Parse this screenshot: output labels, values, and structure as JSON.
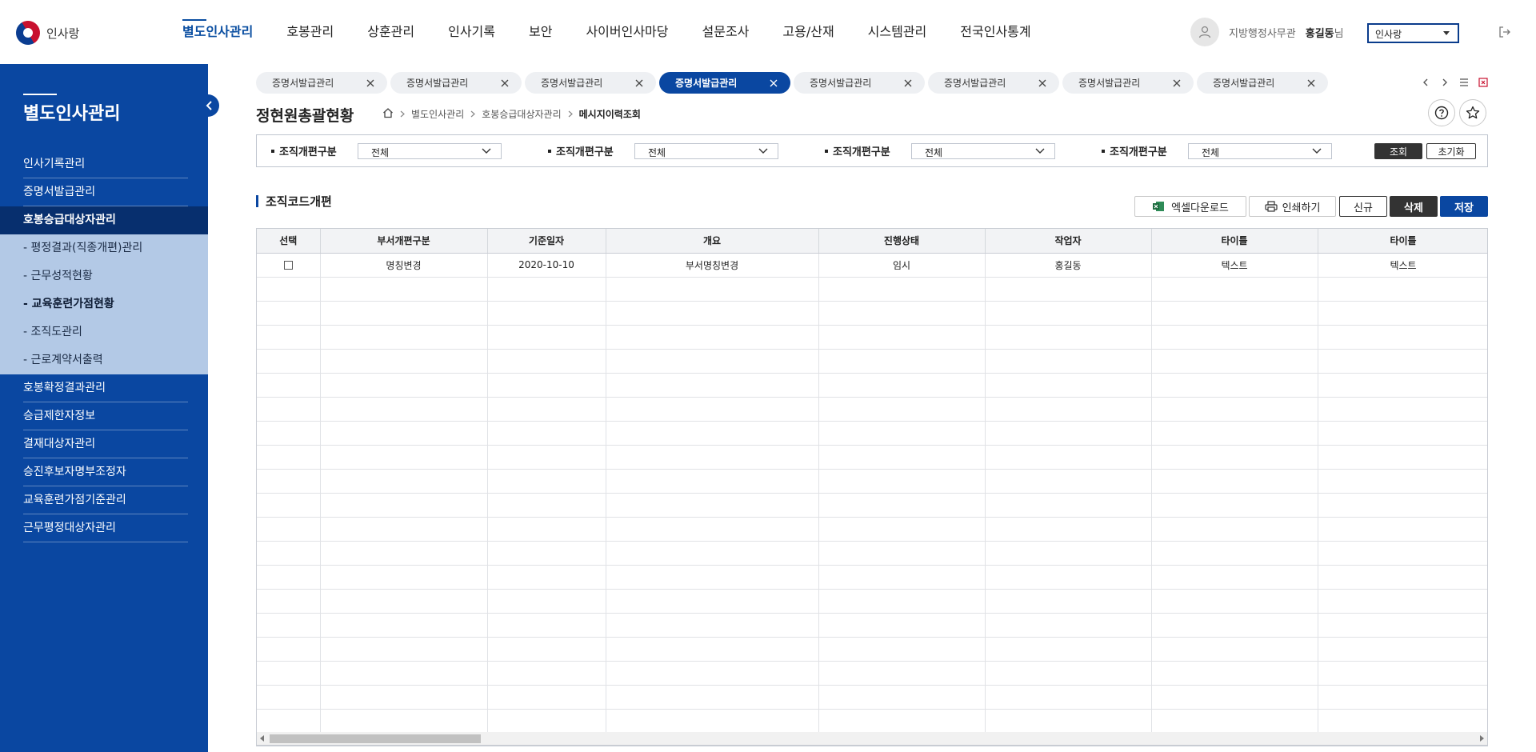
{
  "brand": {
    "name": "인사랑"
  },
  "gnb": [
    {
      "label": "별도인사관리",
      "active": true
    },
    {
      "label": "호봉관리"
    },
    {
      "label": "상훈관리"
    },
    {
      "label": "인사기록"
    },
    {
      "label": "보안"
    },
    {
      "label": "사이버인사마당"
    },
    {
      "label": "설문조사"
    },
    {
      "label": "고용/산재"
    },
    {
      "label": "시스템관리"
    },
    {
      "label": "전국인사통계"
    }
  ],
  "user": {
    "org": "지방행정사무관",
    "name": "홍길동",
    "suffix": "님",
    "system_select": "인사랑"
  },
  "sidebar": {
    "title": "별도인사관리",
    "items": [
      {
        "label": "인사기록관리"
      },
      {
        "label": "증명서발급관리"
      },
      {
        "label": "호봉승급대상자관리",
        "active": true
      },
      {
        "label": "호봉확정결과관리"
      },
      {
        "label": "승급제한자정보"
      },
      {
        "label": "결재대상자관리"
      },
      {
        "label": "승진후보자명부조정자"
      },
      {
        "label": "교육훈련가점기준관리"
      },
      {
        "label": "근무평정대상자관리"
      }
    ],
    "sub_items": [
      {
        "label": "- 평정결과(직종개편)관리"
      },
      {
        "label": "- 근무성적현황"
      },
      {
        "label": "- 교육훈련가점현황",
        "active": true
      },
      {
        "label": "- 조직도관리"
      },
      {
        "label": "- 근로계약서출력"
      }
    ]
  },
  "tabs": [
    {
      "label": "증명서발급관리"
    },
    {
      "label": "증명서발급관리"
    },
    {
      "label": "증명서발급관리"
    },
    {
      "label": "증명서발급관리",
      "active": true
    },
    {
      "label": "증명서발급관리"
    },
    {
      "label": "증명서발급관리"
    },
    {
      "label": "증명서발급관리"
    },
    {
      "label": "증명서발급관리"
    }
  ],
  "page": {
    "title": "정현원총괄현황",
    "breadcrumb": [
      "별도인사관리",
      "호봉승급대상자관리",
      "메시지이력조회"
    ]
  },
  "search": {
    "fields": [
      {
        "label": "조직개편구분",
        "value": "전체"
      },
      {
        "label": "조직개편구분",
        "value": "전체"
      },
      {
        "label": "조직개편구분",
        "value": "전체"
      },
      {
        "label": "조직개편구분",
        "value": "전체"
      }
    ],
    "search_label": "조회",
    "reset_label": "초기화"
  },
  "section": {
    "title": "조직코드개편",
    "excel_label": "엑셀다운로드",
    "print_label": "인쇄하기",
    "new_label": "신규",
    "delete_label": "삭제",
    "save_label": "저장"
  },
  "grid": {
    "columns": [
      "선택",
      "부서개편구분",
      "기준일자",
      "개요",
      "진행상태",
      "작업자",
      "타이틀",
      "타이틀"
    ],
    "rows": [
      [
        "",
        "명칭변경",
        "2020-10-10",
        "부서명칭변경",
        "임시",
        "홍길동",
        "텍스트",
        "텍스트"
      ]
    ],
    "empty_rows": 19
  },
  "colors": {
    "brand": "#0a47a1",
    "sidebar_dark": "#072f6e",
    "submenu": "#b3c9e6"
  }
}
